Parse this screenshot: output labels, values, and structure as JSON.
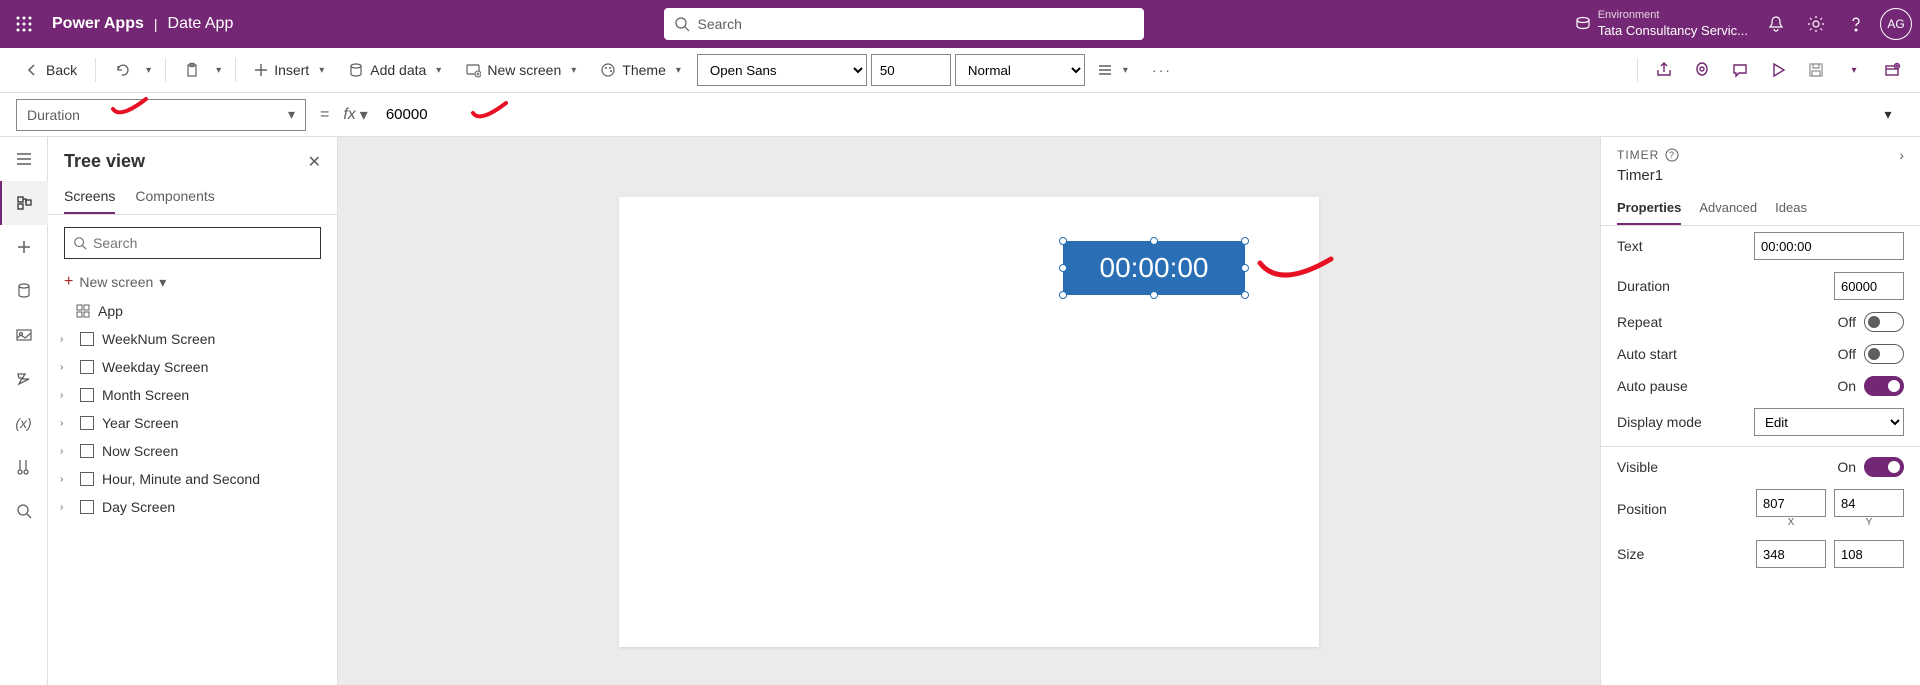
{
  "header": {
    "brand": "Power Apps",
    "app_name": "Date App",
    "search_placeholder": "Search",
    "env_label": "Environment",
    "env_name": "Tata Consultancy Servic...",
    "avatar": "AG"
  },
  "toolbar": {
    "back": "Back",
    "insert": "Insert",
    "add_data": "Add data",
    "new_screen": "New screen",
    "theme": "Theme",
    "font": "Open Sans",
    "font_size": "50",
    "font_weight": "Normal"
  },
  "formula": {
    "property": "Duration",
    "value": "60000"
  },
  "tree": {
    "title": "Tree view",
    "tab_screens": "Screens",
    "tab_components": "Components",
    "search_placeholder": "Search",
    "new_screen": "New screen",
    "app": "App",
    "items": [
      "WeekNum Screen",
      "Weekday Screen",
      "Month Screen",
      "Year Screen",
      "Now Screen",
      "Hour, Minute and Second",
      "Day Screen"
    ]
  },
  "canvas": {
    "timer_display": "00:00:00"
  },
  "props": {
    "type": "TIMER",
    "name": "Timer1",
    "tab_properties": "Properties",
    "tab_advanced": "Advanced",
    "tab_ideas": "Ideas",
    "text_label": "Text",
    "text_value": "00:00:00",
    "duration_label": "Duration",
    "duration_value": "60000",
    "repeat_label": "Repeat",
    "repeat_value": "Off",
    "autostart_label": "Auto start",
    "autostart_value": "Off",
    "autopause_label": "Auto pause",
    "autopause_value": "On",
    "displaymode_label": "Display mode",
    "displaymode_value": "Edit",
    "visible_label": "Visible",
    "visible_value": "On",
    "position_label": "Position",
    "position_x": "807",
    "position_y": "84",
    "x_label": "X",
    "y_label": "Y",
    "size_label": "Size",
    "size_w": "348",
    "size_h": "108"
  }
}
